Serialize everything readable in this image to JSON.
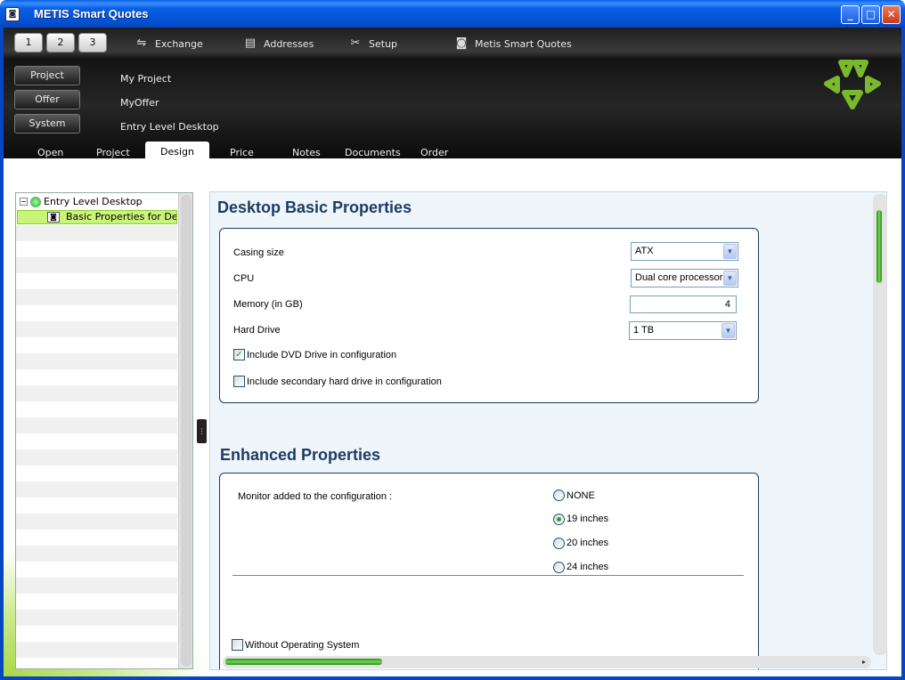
{
  "window": {
    "title": "METIS Smart Quotes",
    "icon": "app-icon",
    "buttons": {
      "minimize": "_",
      "maximize": "□",
      "close": "✕"
    }
  },
  "toolbar": {
    "numbers": [
      "1",
      "2",
      "3"
    ],
    "active_number": "2",
    "links": [
      {
        "label": "Exchange",
        "icon": "exchange-icon"
      },
      {
        "label": "Addresses",
        "icon": "addresses-icon"
      },
      {
        "label": "Setup",
        "icon": "setup-icon"
      },
      {
        "label": "Metis Smart Quotes",
        "icon": "app-icon"
      }
    ]
  },
  "context": {
    "project_label": "Project",
    "project_value": "My Project",
    "offer_label": "Offer",
    "offer_value": "MyOffer",
    "system_label": "System",
    "system_value": "Entry Level Desktop"
  },
  "tabs": [
    "Open",
    "Project",
    "Design",
    "Price",
    "Notes",
    "Documents",
    "Order"
  ],
  "active_tab": "Design",
  "tree": {
    "root": "Entry Level Desktop",
    "child": "Basic Properties for Desktop"
  },
  "basic": {
    "title": "Desktop Basic Properties",
    "casing_label": "Casing size",
    "casing_value": "ATX",
    "cpu_label": "CPU",
    "cpu_value": "Dual core processor",
    "memory_label": "Memory (in GB)",
    "memory_value": "4",
    "hdd_label": "Hard Drive",
    "hdd_value": "1 TB",
    "dvd_label": "Include DVD Drive in configuration",
    "dvd_checked": true,
    "secondary_label": "Include secondary hard drive in configuration",
    "secondary_checked": false
  },
  "enhanced": {
    "title": "Enhanced Properties",
    "monitor_label": "Monitor added to the configuration :",
    "monitor_options": [
      "NONE",
      "19 inches",
      "20 inches",
      "24 inches"
    ],
    "monitor_selected": "19 inches",
    "no_os_label": "Without Operating System",
    "no_os_checked": false
  },
  "colors": {
    "accent_green": "#8cc63f",
    "heading_blue": "#1c3c63",
    "xp_blue": "#0553d6"
  }
}
